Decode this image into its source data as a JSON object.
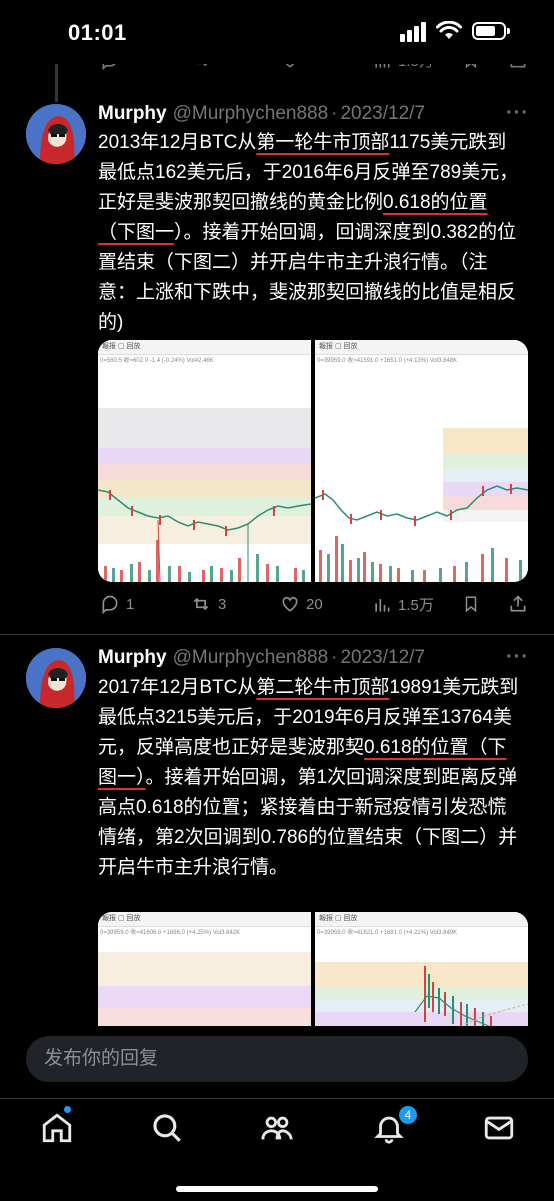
{
  "status_bar": {
    "time": "01:01"
  },
  "top_actions": {
    "views": "1.5万"
  },
  "tweets": [
    {
      "name": "Murphy",
      "handle": "@Murphychen888",
      "date": "2023/12/7",
      "text_parts": [
        "2013年12月BTC从",
        "第一轮牛市顶部",
        "1175美元跌到最低点162美元后，于2016年6月反弹至789美元，正好是斐波那契回撤线的黄金比例",
        "0.618的位置（下图一",
        "）。接着开始回调，回调深度到0.382的位置结束（下图二）并开启牛市主升浪行情。（注意：上涨和下跌中，斐波那契回撤线的比值是相反的)"
      ],
      "chart_left": {
        "toolbar": "報报  ▢  回放",
        "info": "0=560.5  收=602.0  -1.4 (-0.24%)  Vol42.46K"
      },
      "chart_right": {
        "toolbar": "報报  ▢  回放",
        "info": "0=39959.0  收=41591.0  +1651.0 (+4.13%)  Vol3.848K"
      },
      "replies": "1",
      "retweets": "3",
      "likes": "20",
      "views": "1.5万"
    },
    {
      "name": "Murphy",
      "handle": "@Murphychen888",
      "date": "2023/12/7",
      "text_parts": [
        "2017年12月BTC从",
        "第二轮牛市顶部",
        "19891美元跌到最低点3215美元后，于2019年6月反弹至13764美元，反弹高度也正好是斐波那契",
        "0.618的位置（下图一）",
        "。接着开始回调，第1次回调深度到距离反弹高点0.618的位置；紧接着由于新冠疫情引发恐慌情绪，第2次回调到0.786的位置结束（下图二）并开启牛市主升浪行情。"
      ],
      "chart_left": {
        "toolbar": "報报  ▢  回放",
        "info": "0=39959.0  收=41606.0  +1696.0 (+4.25%)  Vol3.842K"
      },
      "chart_right": {
        "toolbar": "報报  ▢  回放",
        "info": "0=39959.0  收=41621.0  +1681.0 (+4.21%)  Vol3.849K"
      }
    }
  ],
  "reply_placeholder": "发布你的回复",
  "notifications_badge": "4",
  "colors": {
    "accent": "#1d9bf0",
    "underline": "#e0302a",
    "background": "#000000"
  }
}
